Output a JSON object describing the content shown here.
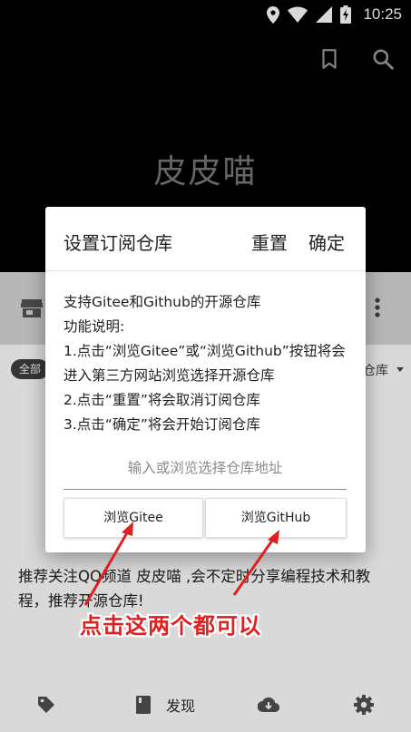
{
  "status_bar": {
    "time": "10:25"
  },
  "header": {
    "app_title": "皮皮喵"
  },
  "main": {
    "filter_chip": "全部",
    "sort_label": "仓库",
    "recommend_text": "推荐关注QQ频道 皮皮喵 ,会不定时分享编程技术和教程，推荐开源仓库!"
  },
  "dialog": {
    "title": "设置订阅仓库",
    "reset_label": "重置",
    "confirm_label": "确定",
    "body_lines": [
      "支持Gitee和Github的开源仓库",
      "功能说明:",
      "1.点击“浏览Gitee”或“浏览Github”按钮将会进入第三方网站浏览选择开源仓库",
      "2.点击“重置”将会取消订阅仓库",
      "3.点击“确定”将会开始订阅仓库"
    ],
    "input_placeholder": "输入或浏览选择仓库地址",
    "input_value": "",
    "browse_gitee_label": "浏览Gitee",
    "browse_github_label": "浏览GitHub"
  },
  "annotation": {
    "text": "点击这两个都可以",
    "color": "#e02020"
  },
  "bottom_nav": {
    "discover_label": "发现"
  },
  "icons": {
    "status": [
      "location-icon",
      "wifi-icon",
      "signal-icon",
      "battery-icon"
    ],
    "header": [
      "bookmark-icon",
      "search-icon"
    ],
    "toolbar": [
      "store-icon",
      "more-vert-icon"
    ],
    "bottom_nav": [
      "tag-icon",
      "book-icon",
      "cloud-download-icon",
      "gear-icon"
    ]
  }
}
